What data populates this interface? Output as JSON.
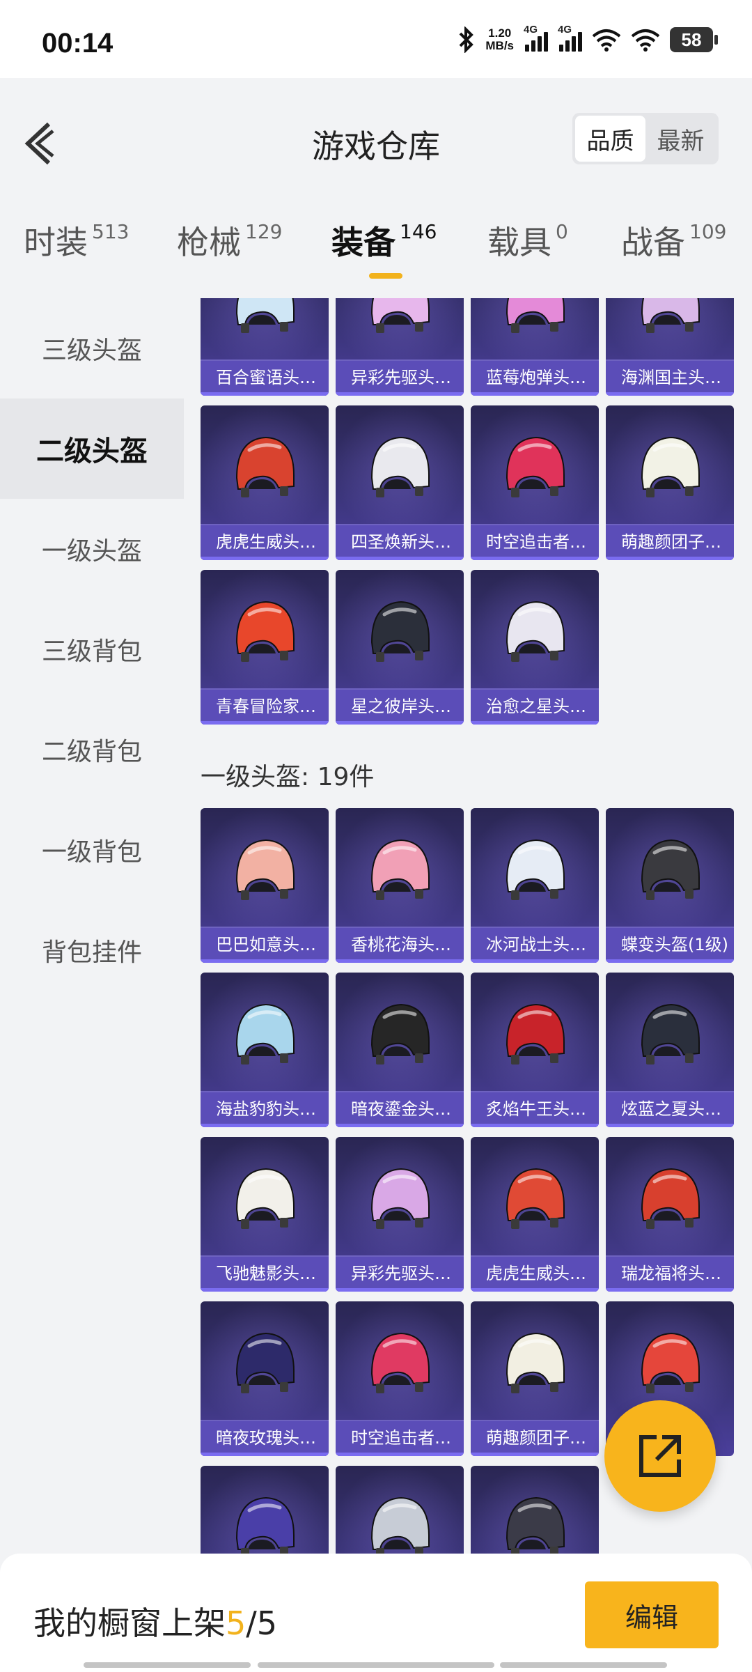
{
  "status": {
    "time": "00:14",
    "net_speed_value": "1.20",
    "net_speed_unit": "MB/s",
    "sim1": "4G",
    "sim2": "4G",
    "battery": "58"
  },
  "header": {
    "title": "游戏仓库",
    "sort_options": [
      "品质",
      "最新"
    ],
    "active_sort": "品质"
  },
  "tabs": [
    {
      "label": "时装",
      "count": "513"
    },
    {
      "label": "枪械",
      "count": "129"
    },
    {
      "label": "装备",
      "count": "146",
      "active": true
    },
    {
      "label": "载具",
      "count": "0"
    },
    {
      "label": "战备",
      "count": "109"
    }
  ],
  "sidebar": {
    "items": [
      "三级头盔",
      "二级头盔",
      "一级头盔",
      "三级背包",
      "二级背包",
      "一级背包",
      "背包挂件"
    ],
    "active": "二级头盔"
  },
  "sections": {
    "level2": {
      "items": [
        {
          "name": "百合蜜语头…",
          "color": "#cfe6f5"
        },
        {
          "name": "异彩先驱头…",
          "color": "#e7b7ec"
        },
        {
          "name": "蓝莓炮弹头…",
          "color": "#e48ad8"
        },
        {
          "name": "海渊国主头…",
          "color": "#d9b8e8"
        },
        {
          "name": "虎虎生威头…",
          "color": "#d9432f"
        },
        {
          "name": "四圣焕新头…",
          "color": "#e9e9ee"
        },
        {
          "name": "时空追击者…",
          "color": "#e0335a"
        },
        {
          "name": "萌趣颜团子…",
          "color": "#f2f2e6"
        },
        {
          "name": "青春冒险家…",
          "color": "#e8472b"
        },
        {
          "name": "星之彼岸头…",
          "color": "#2b2f3a"
        },
        {
          "name": "治愈之星头…",
          "color": "#e8e6f0"
        }
      ]
    },
    "level1": {
      "title": "一级头盔: 19件",
      "items": [
        {
          "name": "巴巴如意头…",
          "color": "#f2b1a3"
        },
        {
          "name": "香桃花海头…",
          "color": "#f1a0b6"
        },
        {
          "name": "冰河战士头…",
          "color": "#e6ecf5"
        },
        {
          "name": "蝶变头盔(1级)",
          "color": "#3a3a3f"
        },
        {
          "name": "海盐豹豹头…",
          "color": "#a9d6ec"
        },
        {
          "name": "暗夜鎏金头…",
          "color": "#262626"
        },
        {
          "name": "炙焰牛王头…",
          "color": "#c8232a"
        },
        {
          "name": "炫蓝之夏头…",
          "color": "#2a2f3c"
        },
        {
          "name": "飞驰魅影头…",
          "color": "#f2f0ea"
        },
        {
          "name": "异彩先驱头…",
          "color": "#d9a8e6"
        },
        {
          "name": "虎虎生威头…",
          "color": "#e04a35"
        },
        {
          "name": "瑞龙福将头…",
          "color": "#d8402e"
        },
        {
          "name": "暗夜玫瑰头…",
          "color": "#2d2a6a"
        },
        {
          "name": "时空追击者…",
          "color": "#e03a62"
        },
        {
          "name": "萌趣颜团子…",
          "color": "#f2efe2"
        },
        {
          "name": "",
          "color": "#e5463b"
        },
        {
          "name": "",
          "color": "#4a3fa8"
        },
        {
          "name": "",
          "color": "#c7ccd6"
        },
        {
          "name": "",
          "color": "#3b3b48"
        }
      ]
    }
  },
  "bottom": {
    "prefix": "我的橱窗上架",
    "current": "5",
    "separator": "/",
    "total": "5",
    "edit_label": "编辑"
  },
  "colors": {
    "accent": "#f8b41c",
    "card_label": "#5b4db8"
  }
}
